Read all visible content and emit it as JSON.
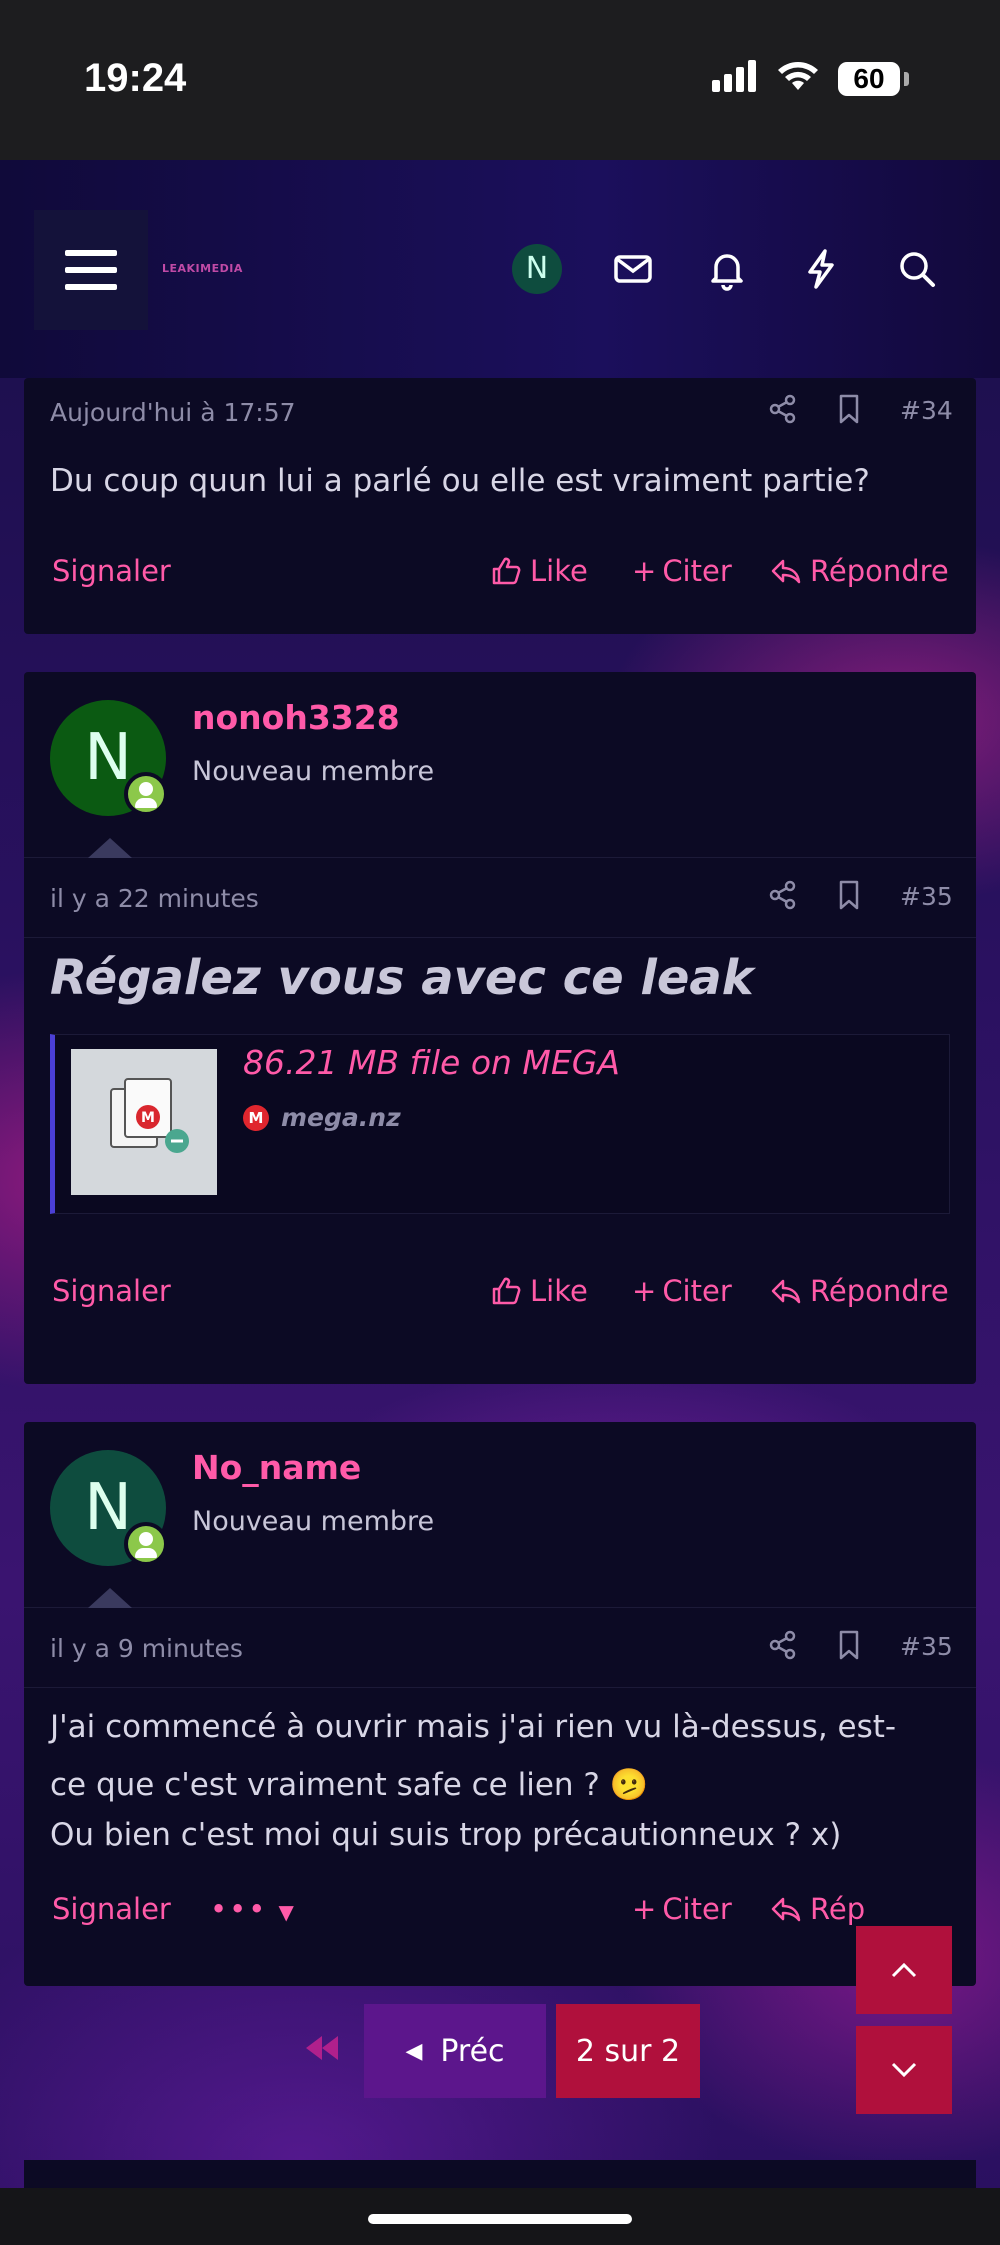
{
  "status_bar": {
    "time": "19:24",
    "battery": "60"
  },
  "header": {
    "logo_text": "LEAKIMEDIA",
    "avatar_letter": "N",
    "icons": [
      "menu-icon",
      "envelope-icon",
      "bell-icon",
      "lightning-icon",
      "search-icon"
    ]
  },
  "posts": [
    {
      "date": "Aujourd'hui à 17:57",
      "number": "#34",
      "body": "Du coup quun lui a parlé ou elle est vraiment partie?",
      "actions": {
        "report": "Signaler",
        "like": "Like",
        "quote": "Citer",
        "reply": "Répondre"
      }
    },
    {
      "username": "nonoh3328",
      "avatar_letter": "N",
      "avatar_color": "#0b5a12",
      "user_title": "Nouveau membre",
      "date": "il y a 22 minutes",
      "number": "#35",
      "headline": "Régalez vous avec ce leak",
      "embed": {
        "title": "86.21 MB file on MEGA",
        "site": "mega.nz",
        "site_badge": "M"
      },
      "actions": {
        "report": "Signaler",
        "like": "Like",
        "quote": "Citer",
        "reply": "Répondre"
      }
    },
    {
      "username": "No_name",
      "avatar_letter": "N",
      "avatar_color": "#0e4c3e",
      "user_title": "Nouveau membre",
      "date": "il y a 9 minutes",
      "number": "#35",
      "body_line1": "J'ai commencé à ouvrir mais j'ai rien vu là-dessus, est-",
      "body_line2": "ce que c'est vraiment safe ce lien ? 🫤",
      "body_line3": "Ou bien c'est moi qui suis trop précautionneux ? x)",
      "actions": {
        "report": "Signaler",
        "more": "•••",
        "quote": "Citer",
        "reply": "Rép"
      }
    }
  ],
  "pagination": {
    "prev_label": "Préc",
    "current": "2 sur 2"
  },
  "colors": {
    "accent": "#ff5aa8",
    "prev_button": "#5c168c",
    "current_page": "#b0103c"
  }
}
